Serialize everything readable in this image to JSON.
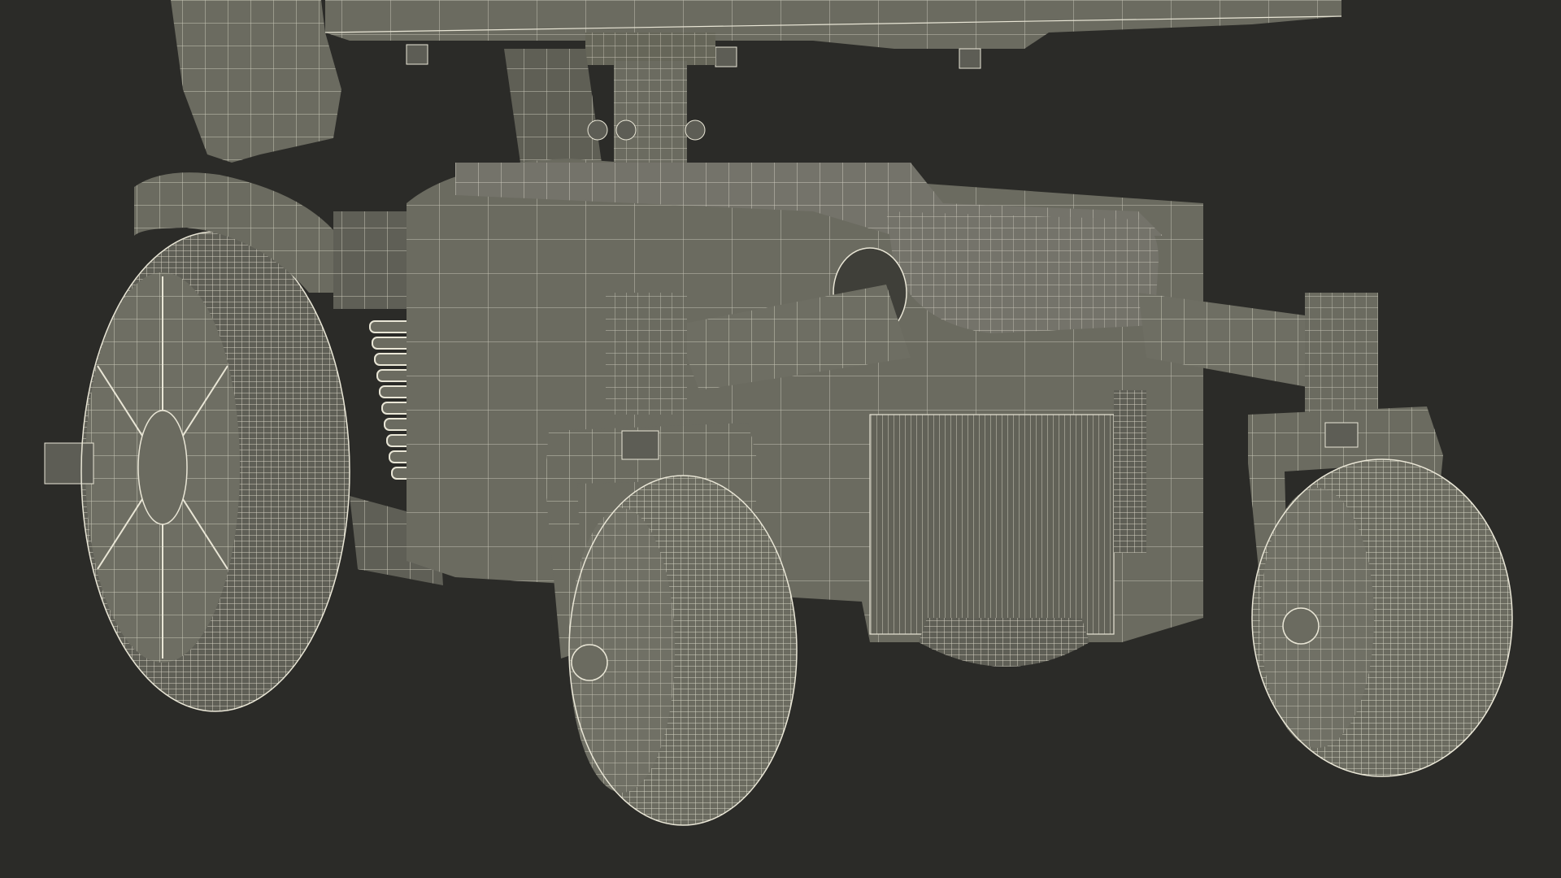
{
  "scene": {
    "subject": "wireframe-3d-render-power-wheelchair-base",
    "background_color": "#2b2b28",
    "mesh_fill_color": "#6b6b60",
    "mesh_fill_light": "#7d7c70",
    "mesh_fill_dark": "#4f4f47",
    "wire_color": "#e9e6d6",
    "shadow_color": "#3a3a35"
  }
}
